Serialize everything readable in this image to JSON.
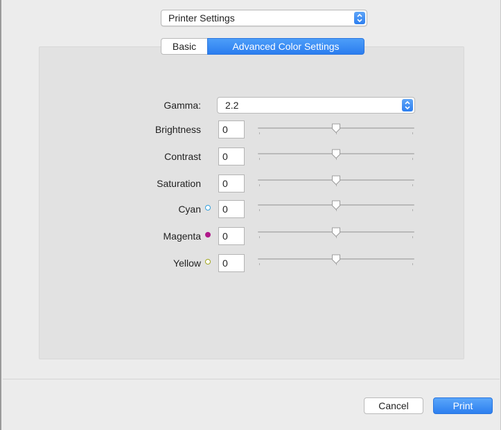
{
  "header": {
    "section_popup": "Printer Settings"
  },
  "tabs": [
    {
      "label": "Basic",
      "active": false
    },
    {
      "label": "Advanced Color Settings",
      "active": true
    }
  ],
  "gamma": {
    "label": "Gamma:",
    "value": "2.2"
  },
  "adjustments": [
    {
      "label": "Brightness",
      "value": "0",
      "dot": null
    },
    {
      "label": "Contrast",
      "value": "0",
      "dot": null
    },
    {
      "label": "Saturation",
      "value": "0",
      "dot": null
    },
    {
      "label": "Cyan",
      "value": "0",
      "dot": {
        "color": "#2f9fdc",
        "filled": false
      }
    },
    {
      "label": "Magenta",
      "value": "0",
      "dot": {
        "color": "#b0198a",
        "filled": true
      }
    },
    {
      "label": "Yellow",
      "value": "0",
      "dot": {
        "color": "#a0a51c",
        "filled": false
      }
    }
  ],
  "footer": {
    "cancel_label": "Cancel",
    "print_label": "Print"
  },
  "colors": {
    "accent": "#2b7def"
  }
}
